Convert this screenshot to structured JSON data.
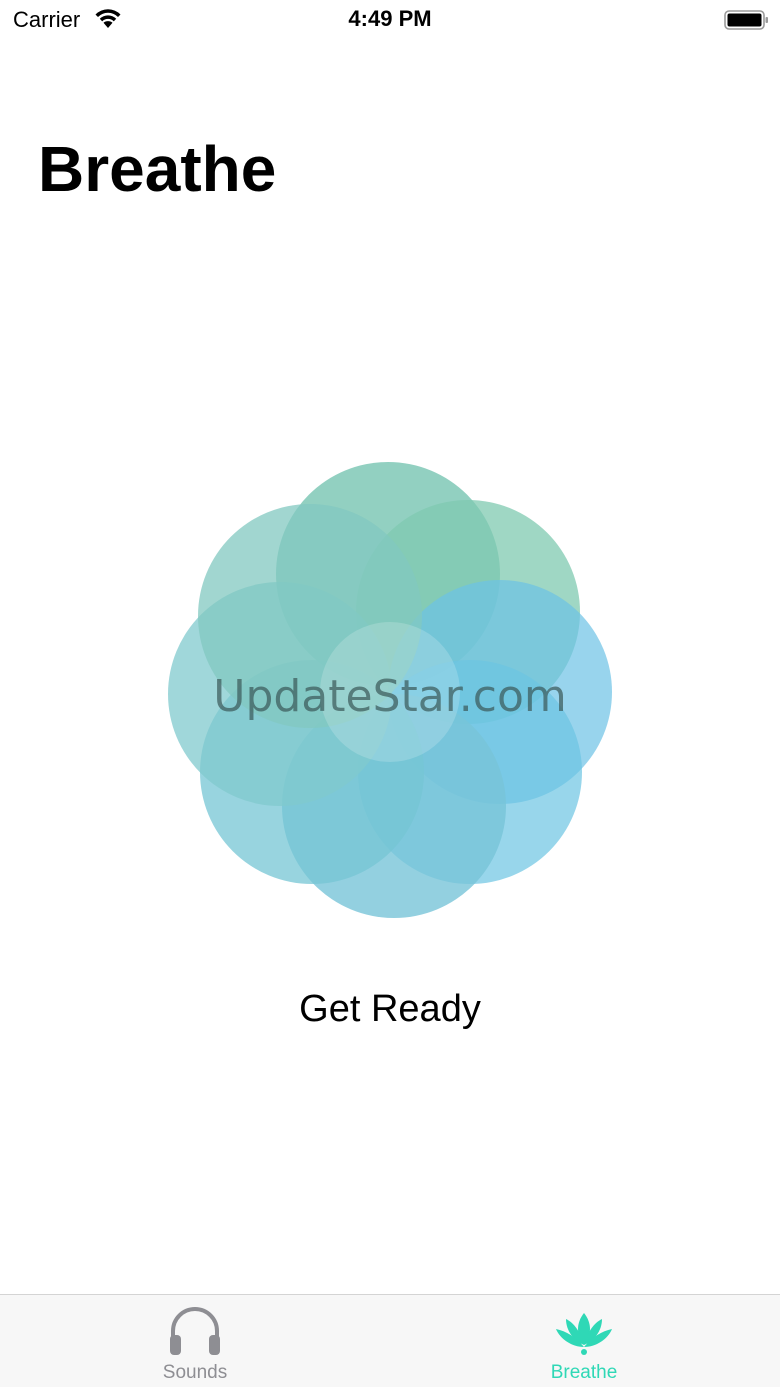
{
  "status_bar": {
    "carrier": "Carrier",
    "time": "4:49 PM"
  },
  "header": {
    "title": "Breathe"
  },
  "main": {
    "watermark": "UpdateStar.com",
    "status_text": "Get Ready"
  },
  "tab_bar": {
    "tabs": [
      {
        "label": "Sounds",
        "icon": "headphones-icon",
        "selected": false,
        "color": "#8e8e93"
      },
      {
        "label": "Breathe",
        "icon": "lotus-icon",
        "selected": true,
        "color": "#2fd8b6"
      }
    ]
  },
  "colors": {
    "accent": "#2fd8b6",
    "petal_green": "#7fc8b6",
    "petal_blue": "#6cc8e0"
  }
}
